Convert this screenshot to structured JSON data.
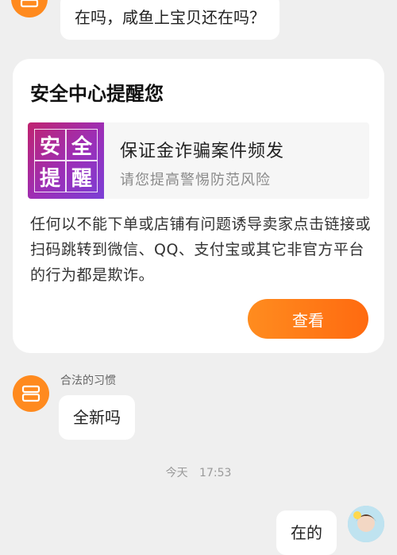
{
  "top_message": {
    "text": "在吗，咸鱼上宝贝还在吗？"
  },
  "security_card": {
    "title": "安全中心提醒您",
    "badge_chars": [
      "安",
      "全",
      "提",
      "醒"
    ],
    "alert_title": "保证金诈骗案件频发",
    "alert_subtitle": "请您提高警惕防范风险",
    "body": "任何以不能下单或店铺有问题诱导卖家点击链接或扫码跳转到微信、QQ、支付宝或其它非官方平台的行为都是欺诈。",
    "view_button_label": "查看"
  },
  "seller_message": {
    "sender_name": "合法的习惯",
    "text": "全新吗"
  },
  "timestamp": {
    "day": "今天",
    "time": "17:53"
  },
  "my_message": {
    "text": "在的"
  },
  "colors": {
    "accent": "#ff7a18",
    "background": "#efefef",
    "badge": "#a42aa8"
  },
  "icons": {
    "seller_avatar": "store-icon",
    "my_avatar": "user-photo"
  }
}
